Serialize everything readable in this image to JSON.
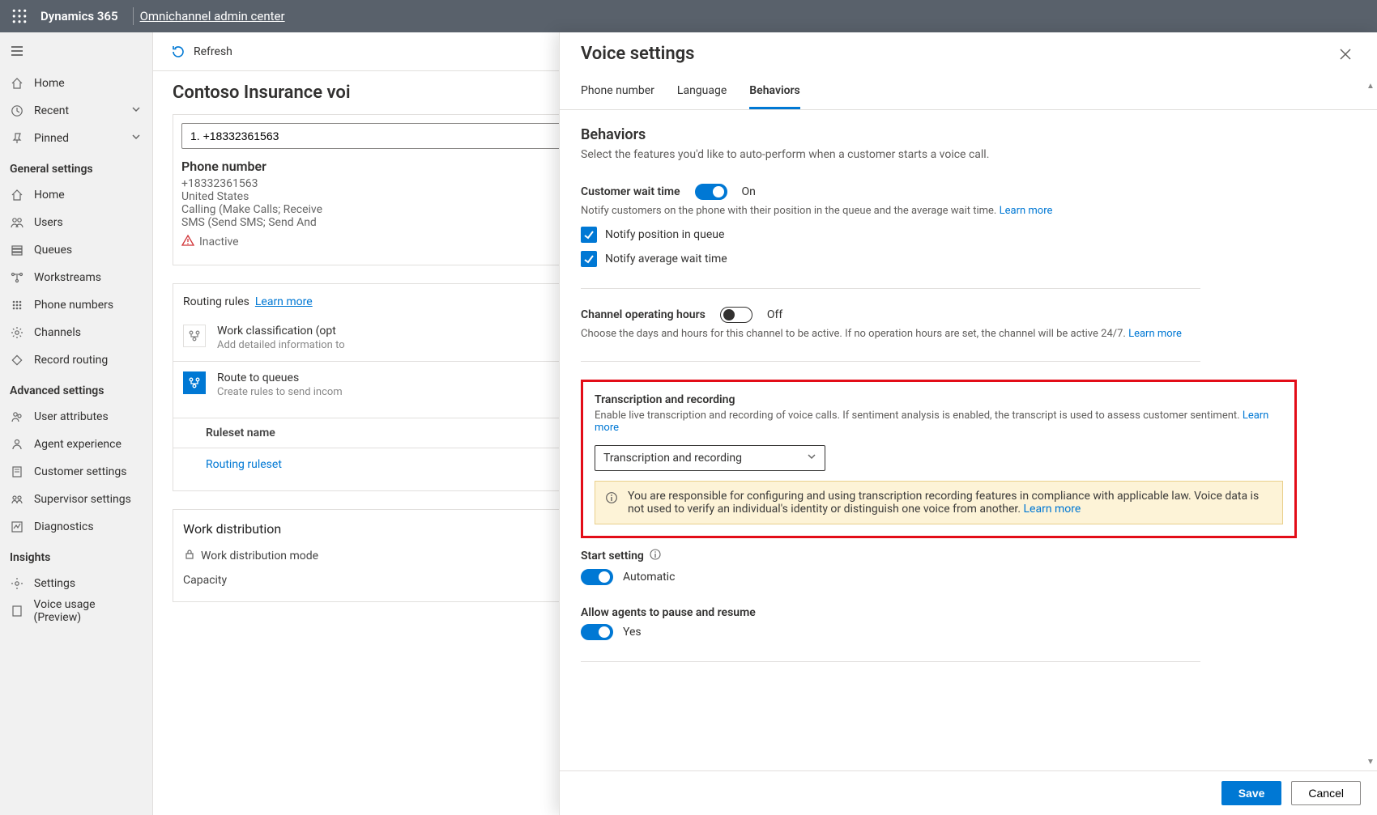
{
  "topbar": {
    "brand": "Dynamics 365",
    "breadcrumb": "Omnichannel admin center"
  },
  "sidebar": {
    "top": [
      {
        "label": "Home",
        "icon": "home"
      },
      {
        "label": "Recent",
        "icon": "clock",
        "expand": true
      },
      {
        "label": "Pinned",
        "icon": "pin",
        "expand": true
      }
    ],
    "general_heading": "General settings",
    "general": [
      {
        "label": "Home",
        "icon": "home"
      },
      {
        "label": "Users",
        "icon": "users"
      },
      {
        "label": "Queues",
        "icon": "layers"
      },
      {
        "label": "Workstreams",
        "icon": "flow"
      },
      {
        "label": "Phone numbers",
        "icon": "grid"
      },
      {
        "label": "Channels",
        "icon": "gear"
      },
      {
        "label": "Record routing",
        "icon": "diamond"
      }
    ],
    "advanced_heading": "Advanced settings",
    "advanced": [
      {
        "label": "User attributes",
        "icon": "persons"
      },
      {
        "label": "Agent experience",
        "icon": "person"
      },
      {
        "label": "Customer settings",
        "icon": "doc"
      },
      {
        "label": "Supervisor settings",
        "icon": "team"
      },
      {
        "label": "Diagnostics",
        "icon": "chart"
      }
    ],
    "insights_heading": "Insights",
    "insights": [
      {
        "label": "Settings",
        "icon": "gear"
      },
      {
        "label": "Voice usage (Preview)",
        "icon": "doc"
      }
    ]
  },
  "cmdbar": {
    "refresh": "Refresh"
  },
  "page": {
    "title": "Contoso Insurance voi",
    "phone_input_value": "1. +18332361563",
    "card": {
      "title": "Phone number",
      "number": "+18332361563",
      "country": "United States",
      "calling_line": "Calling (Make Calls; Receive",
      "sms_line": "SMS (Send SMS; Send And",
      "inactive": "Inactive"
    },
    "routing": {
      "head": "Routing rules",
      "learn_more": "Learn more",
      "work_class_title": "Work classification (opt",
      "work_class_desc": "Add detailed information to",
      "route_title": "Route to queues",
      "route_desc": "Create rules to send incom",
      "ruleset_col": "Ruleset name",
      "ruleset_value": "Routing ruleset"
    },
    "work_dist": {
      "title": "Work distribution",
      "mode": "Work distribution mode",
      "capacity": "Capacity"
    }
  },
  "flyout": {
    "title": "Voice settings",
    "tabs": {
      "phone": "Phone number",
      "language": "Language",
      "behaviors": "Behaviors"
    },
    "selected_tab": "behaviors",
    "section_title": "Behaviors",
    "section_desc": "Select the features you'd like to auto-perform when a customer starts a voice call.",
    "wait": {
      "label": "Customer wait time",
      "state": "On",
      "desc": "Notify customers on the phone with their position in the queue and the average wait time.",
      "learn": "Learn more",
      "check1": "Notify position in queue",
      "check2": "Notify average wait time"
    },
    "hours": {
      "label": "Channel operating hours",
      "state": "Off",
      "desc": "Choose the days and hours for this channel to be active. If no operation hours are set, the channel will be active 24/7.",
      "learn": "Learn more"
    },
    "transcription": {
      "label": "Transcription and recording",
      "desc": "Enable live transcription and recording of voice calls. If sentiment analysis is enabled, the transcript is used to assess customer sentiment.",
      "learn": "Learn more",
      "select_value": "Transcription and recording",
      "banner": "You are responsible for configuring and using transcription recording features in compliance with applicable law. Voice data is not used to verify an individual's identity or distinguish one voice from another.",
      "banner_learn": "Learn more"
    },
    "start": {
      "label": "Start setting",
      "value": "Automatic"
    },
    "pause": {
      "label": "Allow agents to pause and resume",
      "value": "Yes"
    },
    "footer": {
      "save": "Save",
      "cancel": "Cancel"
    }
  }
}
